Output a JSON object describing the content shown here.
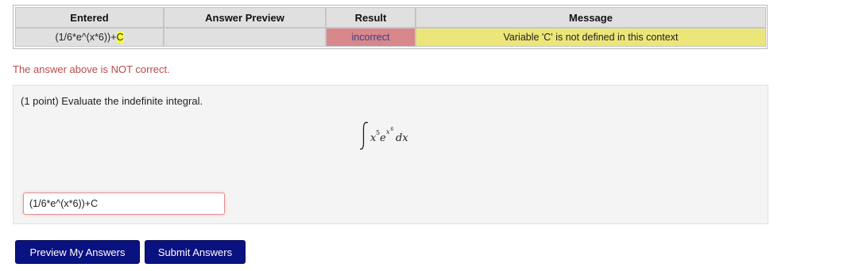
{
  "results_table": {
    "headers": [
      "Entered",
      "Answer Preview",
      "Result",
      "Message"
    ],
    "row": {
      "entered_prefix": "(1/6*e^(x*6))+",
      "entered_highlight": "C",
      "preview": "",
      "result": "incorrect",
      "message": "Variable 'C' is not defined in this context"
    }
  },
  "status_message": "The answer above is NOT correct.",
  "problem": {
    "text": "(1 point) Evaluate the indefinite integral."
  },
  "answer": {
    "value": "(1/6*e^(x*6))+C"
  },
  "buttons": {
    "preview_label": "Preview My Answers",
    "submit_label": "Submit Answers"
  },
  "colors": {
    "incorrect_bg": "#d8878b",
    "message_bg": "#ece67a",
    "button_bg": "#0a1180",
    "error_text": "#b94a48"
  }
}
